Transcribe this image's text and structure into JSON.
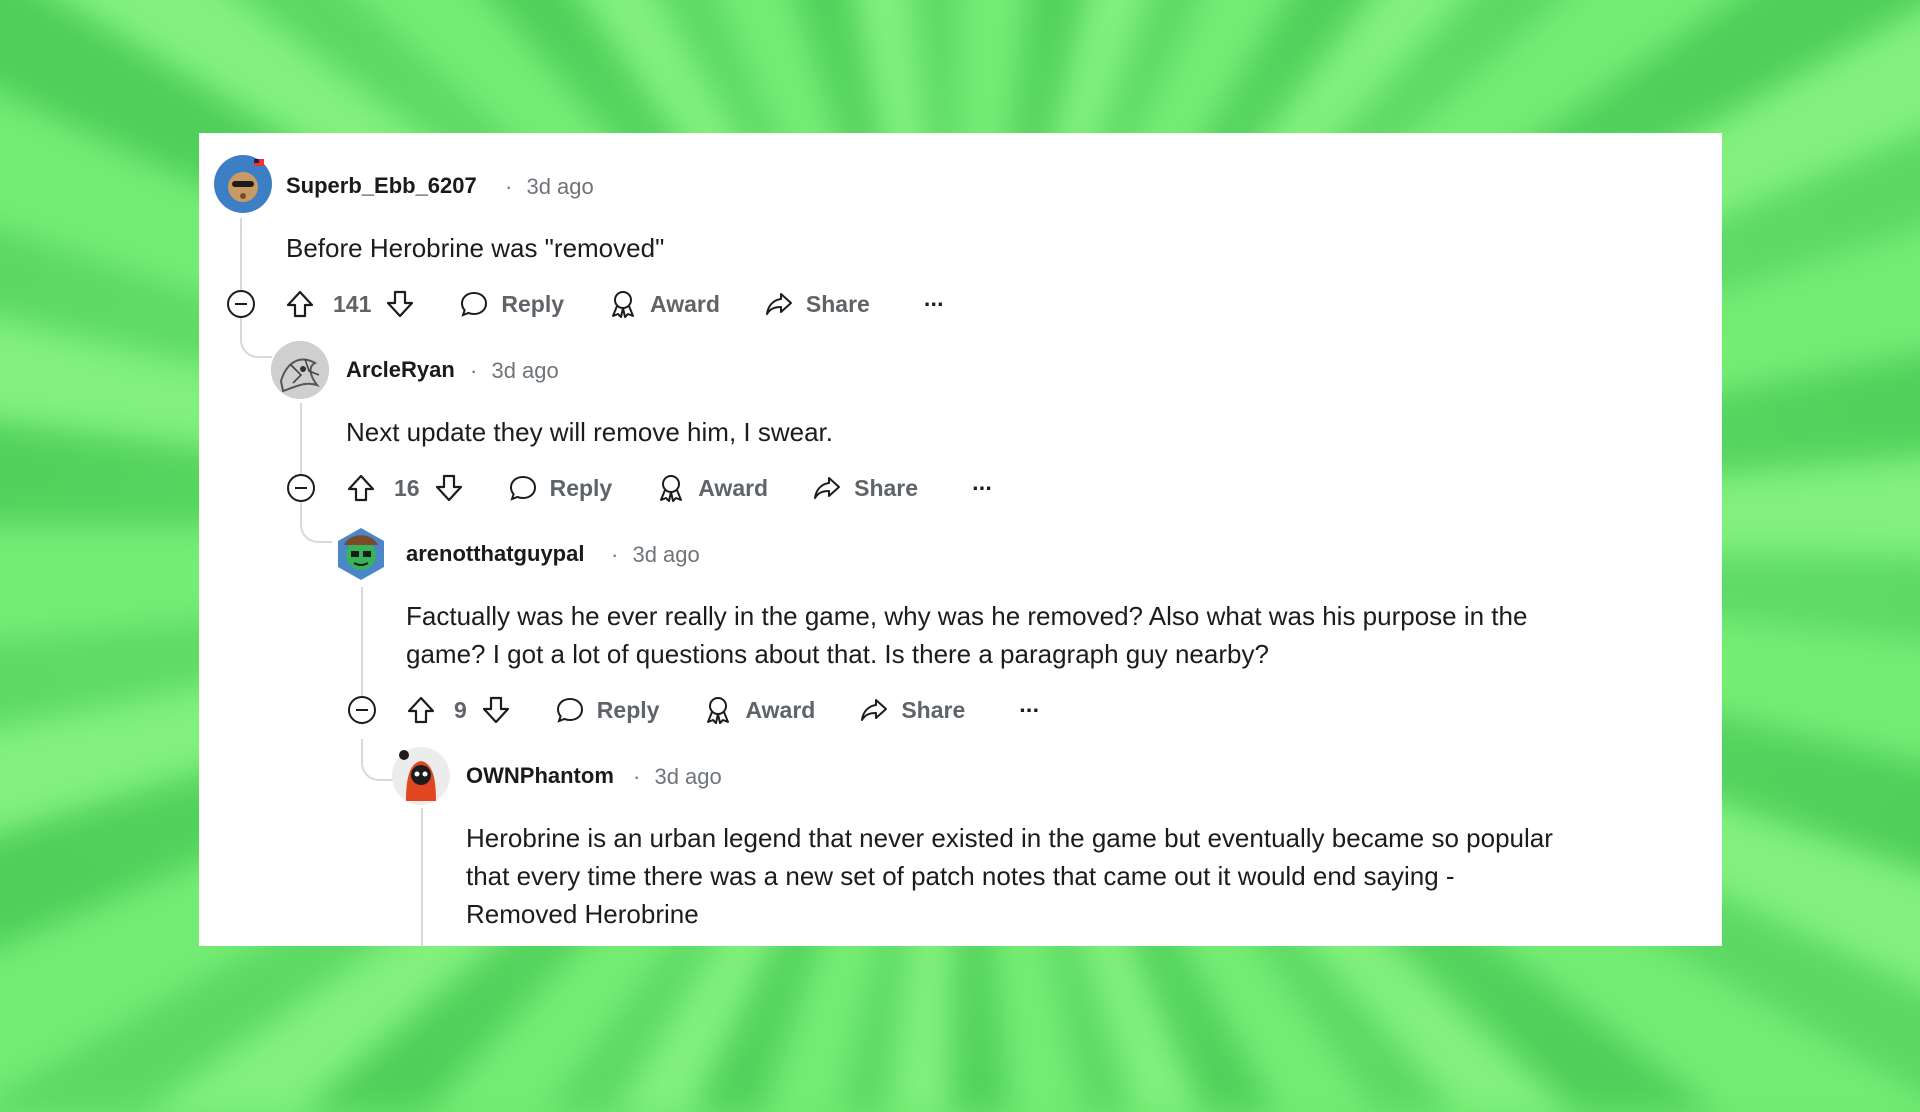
{
  "comments": [
    {
      "username": "Superb_Ebb_6207",
      "separator": "·",
      "time": "3d ago",
      "body_lines": [
        "Before Herobrine was \"removed\""
      ],
      "score": "141",
      "reply_label": "Reply",
      "award_label": "Award",
      "share_label": "Share",
      "more_label": "···",
      "avatar_colors": {
        "bg": "#3d7fc4",
        "face": "#c79b63"
      }
    },
    {
      "username": "ArcleRyan",
      "separator": "·",
      "time": "3d ago",
      "body_lines": [
        "Next update they will remove him, I swear."
      ],
      "score": "16",
      "reply_label": "Reply",
      "award_label": "Award",
      "share_label": "Share",
      "more_label": "···",
      "avatar_colors": {
        "bg": "#b9b9b9",
        "face": "#6d6d6d"
      }
    },
    {
      "username": "arenotthatguypal",
      "separator": "·",
      "time": "3d ago",
      "body_lines": [
        "Factually was he ever really in the game, why was he removed? Also what was his purpose in the",
        "game? I got a lot of questions about that. Is there a paragraph guy nearby?"
      ],
      "score": "9",
      "reply_label": "Reply",
      "award_label": "Award",
      "share_label": "Share",
      "more_label": "···",
      "avatar_colors": {
        "bg": "#4a86c8",
        "face": "#39b35a"
      }
    },
    {
      "username": "OWNPhantom",
      "separator": "·",
      "time": "3d ago",
      "body_lines": [
        "Herobrine is an urban legend that never existed in the game but eventually became so popular",
        "that every time there was a new set of patch notes that came out it would end saying -",
        "Removed Herobrine"
      ],
      "avatar_colors": {
        "bg": "#e8e8e8",
        "face": "#e0461f"
      }
    }
  ],
  "colors": {
    "background_green": "#6ee86f",
    "thread_line": "#d5dade",
    "action_text": "#5f6468",
    "meta_text": "#6f7479"
  }
}
